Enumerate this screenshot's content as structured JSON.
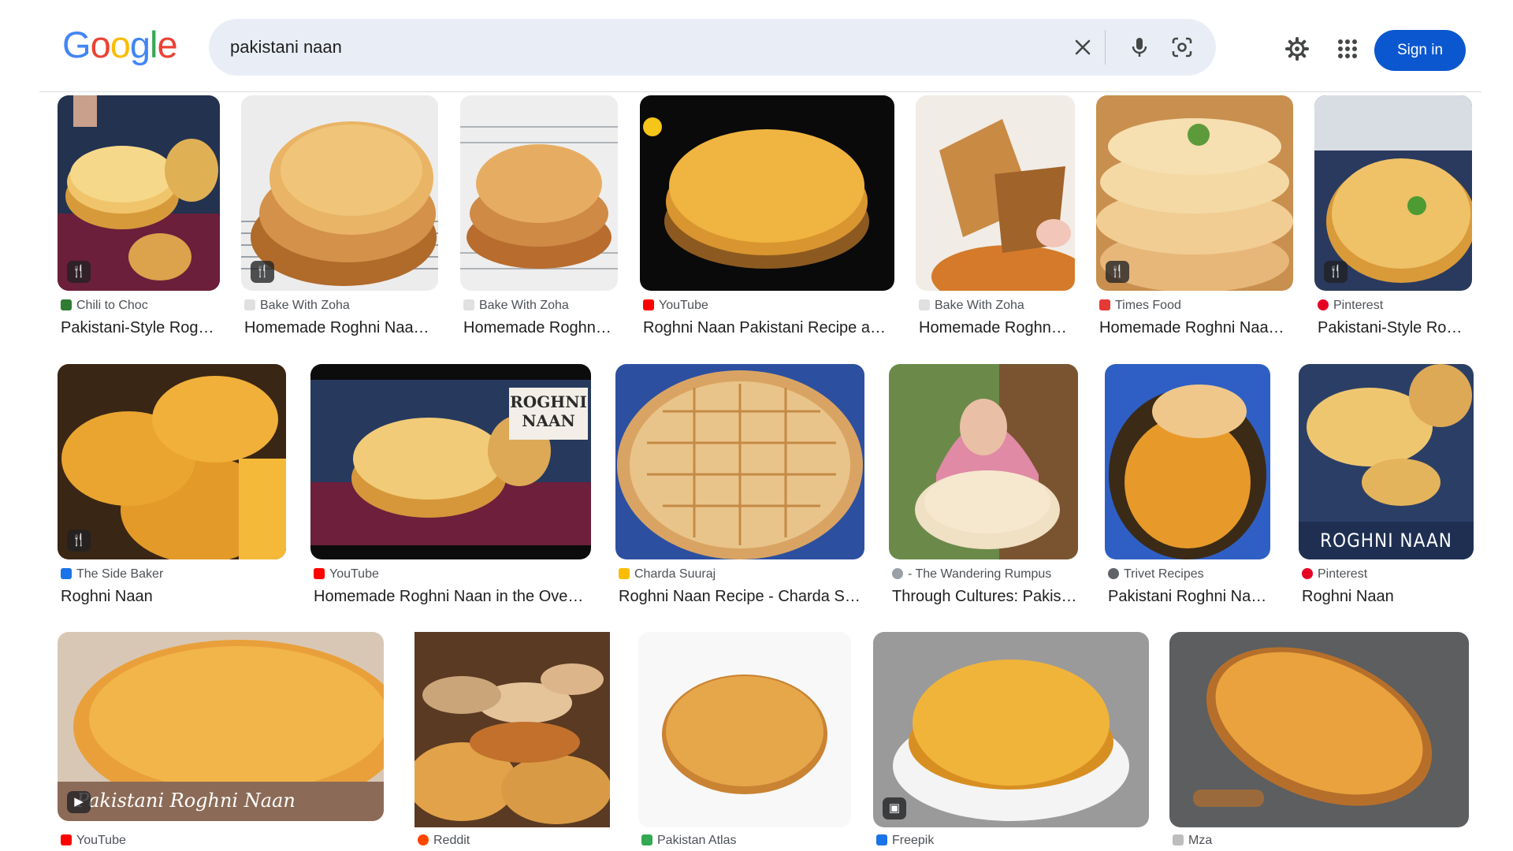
{
  "logo": {
    "letters": [
      "G",
      "o",
      "o",
      "g",
      "l",
      "e"
    ],
    "colors": [
      "#4285f4",
      "#ea4335",
      "#fbbc05",
      "#4285f4",
      "#34a853",
      "#ea4335"
    ]
  },
  "search": {
    "query": "pakistani naan"
  },
  "header": {
    "sign_in_label": "Sign in"
  },
  "icons": {
    "clear": "close-icon",
    "voice": "microphone-icon",
    "lens": "camera-lens-icon",
    "settings": "gear-icon",
    "apps": "apps-grid-icon",
    "recipe_badge": "fork-knife-icon",
    "video_badge": "play-icon",
    "image_badge": "image-icon"
  },
  "colors": {
    "accent": "#0b57d0",
    "search_bg": "#e9eef6",
    "youtube": "#ff0000",
    "pinterest": "#e60023"
  },
  "results": {
    "row1": [
      {
        "source": "Chili to Choc",
        "title": "Pakistani-Style Rog…",
        "badge": "recipe"
      },
      {
        "source": "Bake With Zoha",
        "title": "Homemade Roghni Naa…",
        "badge": "recipe"
      },
      {
        "source": "Bake With Zoha",
        "title": "Homemade Roghn…",
        "badge": ""
      },
      {
        "source": "YouTube",
        "title": "Roghni Naan Pakistani Recipe a…",
        "badge": ""
      },
      {
        "source": "Bake With Zoha",
        "title": "Homemade Roghn…",
        "badge": ""
      },
      {
        "source": "Times Food",
        "title": "Homemade Roghni Naa…",
        "badge": "recipe"
      },
      {
        "source": "Pinterest",
        "title": "Pakistani-Style Ro…",
        "badge": "recipe"
      }
    ],
    "row2": [
      {
        "source": "The Side Baker",
        "title": "Roghni Naan",
        "badge": "recipe"
      },
      {
        "source": "YouTube",
        "title": "Homemade Roghni Naan in the Oven…",
        "badge": "",
        "overlay": "ROGHNI NAAN"
      },
      {
        "source": "Charda Suuraj",
        "title": "Roghni Naan Recipe - Charda S…",
        "badge": ""
      },
      {
        "source": "- The Wandering Rumpus",
        "title": "Through Cultures: Pakis…",
        "badge": ""
      },
      {
        "source": "Trivet Recipes",
        "title": "Pakistani Roghni Na…",
        "badge": ""
      },
      {
        "source": "Pinterest",
        "title": "Roghni Naan",
        "badge": "",
        "overlay": "ROGHNI NAAN"
      }
    ],
    "row3": [
      {
        "source": "YouTube",
        "badge": "video",
        "overlay": "Pakistani Roghni Naan"
      },
      {
        "source": "Reddit",
        "badge": ""
      },
      {
        "source": "Pakistan Atlas",
        "badge": ""
      },
      {
        "source": "Freepik",
        "badge": "image"
      },
      {
        "source": "Mza",
        "badge": ""
      }
    ]
  }
}
